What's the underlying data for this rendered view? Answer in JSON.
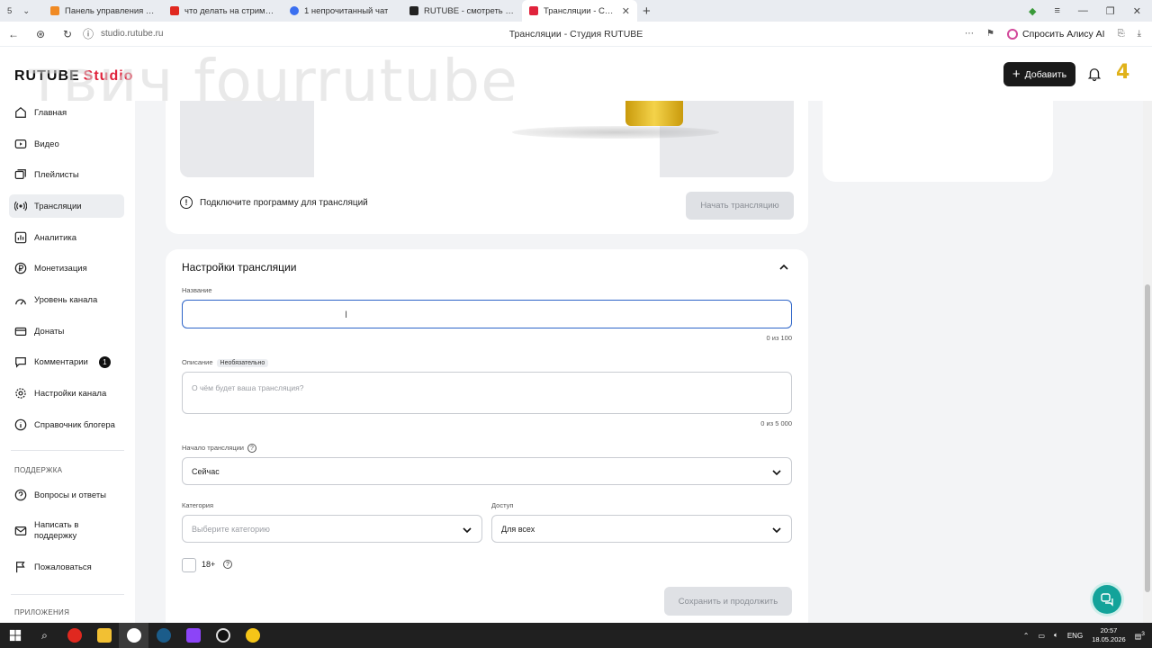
{
  "browser": {
    "tab_number": "5",
    "tabs": [
      {
        "label": "Панель управления - Don",
        "color": "#f08a24"
      },
      {
        "label": "что делать на стриме — Я",
        "color": "#e0281f"
      },
      {
        "label": "1 непрочитанный чат",
        "color": "#3a6ff0"
      },
      {
        "label": "RUTUBE - смотреть виде",
        "color": "#222222"
      },
      {
        "label": "Трансляции - Студия R",
        "color": "#e0233c"
      }
    ],
    "url": "studio.rutube.ru",
    "page_title": "Трансляции - Студия RUTUBE",
    "alice_label": "Спросить Алису AI"
  },
  "header": {
    "logo": "RUTUBE",
    "logo_studio": "Studio",
    "watermark": "твич fourrutube",
    "add_button": "Добавить",
    "badge": "4"
  },
  "sidebar": {
    "items": [
      {
        "label": "Главная",
        "icon": "home-icon"
      },
      {
        "label": "Видео",
        "icon": "video-icon"
      },
      {
        "label": "Плейлисты",
        "icon": "playlist-icon"
      },
      {
        "label": "Трансляции",
        "icon": "broadcast-icon"
      },
      {
        "label": "Аналитика",
        "icon": "analytics-icon"
      },
      {
        "label": "Монетизация",
        "icon": "ruble-icon"
      },
      {
        "label": "Уровень канала",
        "icon": "level-icon"
      },
      {
        "label": "Донаты",
        "icon": "donate-icon"
      },
      {
        "label": "Комментарии",
        "icon": "comment-icon",
        "count": "1"
      },
      {
        "label": "Настройки канала",
        "icon": "gear-icon"
      },
      {
        "label": "Справочник блогера",
        "icon": "info-icon"
      }
    ],
    "support_heading": "ПОДДЕРЖКА",
    "support_items": [
      {
        "label": "Вопросы и ответы",
        "icon": "question-icon"
      },
      {
        "label": "Написать в поддержку",
        "icon": "mail-icon"
      },
      {
        "label": "Пожаловаться",
        "icon": "flag-icon"
      }
    ],
    "apps_heading": "ПРИЛОЖЕНИЯ"
  },
  "stream": {
    "connect_notice": "Подключите программу для трансляций",
    "start_button": "Начать трансляцию"
  },
  "settings": {
    "title": "Настройки трансляции",
    "name_label": "Название",
    "name_value": "",
    "name_counter": "0 из 100",
    "description_label": "Описание",
    "optional_tag": "Необязательно",
    "description_placeholder": "О чём будет ваша трансляция?",
    "description_counter": "0 из 5 000",
    "start_label": "Начало трансляции",
    "start_value": "Сейчас",
    "category_label": "Категория",
    "category_placeholder": "Выберите категорию",
    "access_label": "Доступ",
    "access_value": "Для всех",
    "age_label": "18+",
    "save_button": "Сохранить и продолжить"
  },
  "taskbar": {
    "lang": "ENG",
    "time": "20:57",
    "date": "18.05.2026",
    "notifications": "3"
  }
}
